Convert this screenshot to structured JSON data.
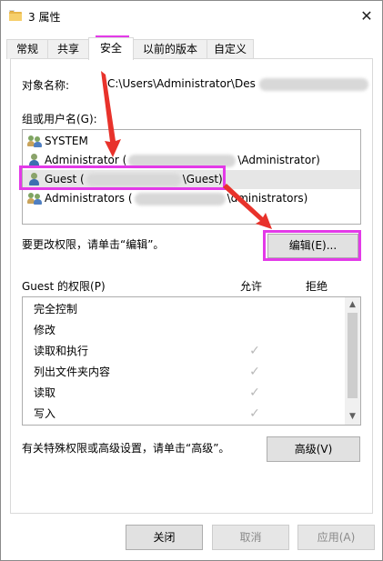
{
  "window": {
    "title": "3 属性",
    "close_glyph": "✕"
  },
  "tabs": [
    {
      "label": "常规",
      "active": false
    },
    {
      "label": "共享",
      "active": false
    },
    {
      "label": "安全",
      "active": true
    },
    {
      "label": "以前的版本",
      "active": false
    },
    {
      "label": "自定义",
      "active": false
    }
  ],
  "object": {
    "label": "对象名称:",
    "value": "C:\\Users\\Administrator\\Des"
  },
  "groups": {
    "label": "组或用户名(G):",
    "items": [
      {
        "text": "SYSTEM",
        "suffix": "",
        "icon": "user-group-icon",
        "selected": false
      },
      {
        "text": "Administrator (",
        "suffix": "\\Administrator)",
        "icon": "user-icon",
        "selected": false
      },
      {
        "text": "Guest (",
        "suffix": "\\Guest)",
        "icon": "user-icon",
        "selected": true
      },
      {
        "text": "Administrators (",
        "suffix": "\\dministrators)",
        "icon": "user-group-icon",
        "selected": false
      }
    ]
  },
  "change_hint": "要更改权限，请单击“编辑”。",
  "edit_button": "编辑(E)...",
  "permissions": {
    "title": "Guest 的权限(P)",
    "allow_header": "允许",
    "deny_header": "拒绝",
    "rows": [
      {
        "name": "完全控制",
        "allow": false,
        "deny": false
      },
      {
        "name": "修改",
        "allow": false,
        "deny": false
      },
      {
        "name": "读取和执行",
        "allow": true,
        "deny": false
      },
      {
        "name": "列出文件夹内容",
        "allow": true,
        "deny": false
      },
      {
        "name": "读取",
        "allow": true,
        "deny": false
      },
      {
        "name": "写入",
        "allow": true,
        "deny": false
      }
    ],
    "check_glyph": "✓"
  },
  "advanced_hint": "有关特殊权限或高级设置，请单击“高级”。",
  "advanced_button": "高级(V)",
  "footer": {
    "ok": "关闭",
    "cancel": "取消",
    "apply": "应用(A)"
  },
  "colors": {
    "annotation": "#e33ae8",
    "arrow": "#e8322b"
  }
}
